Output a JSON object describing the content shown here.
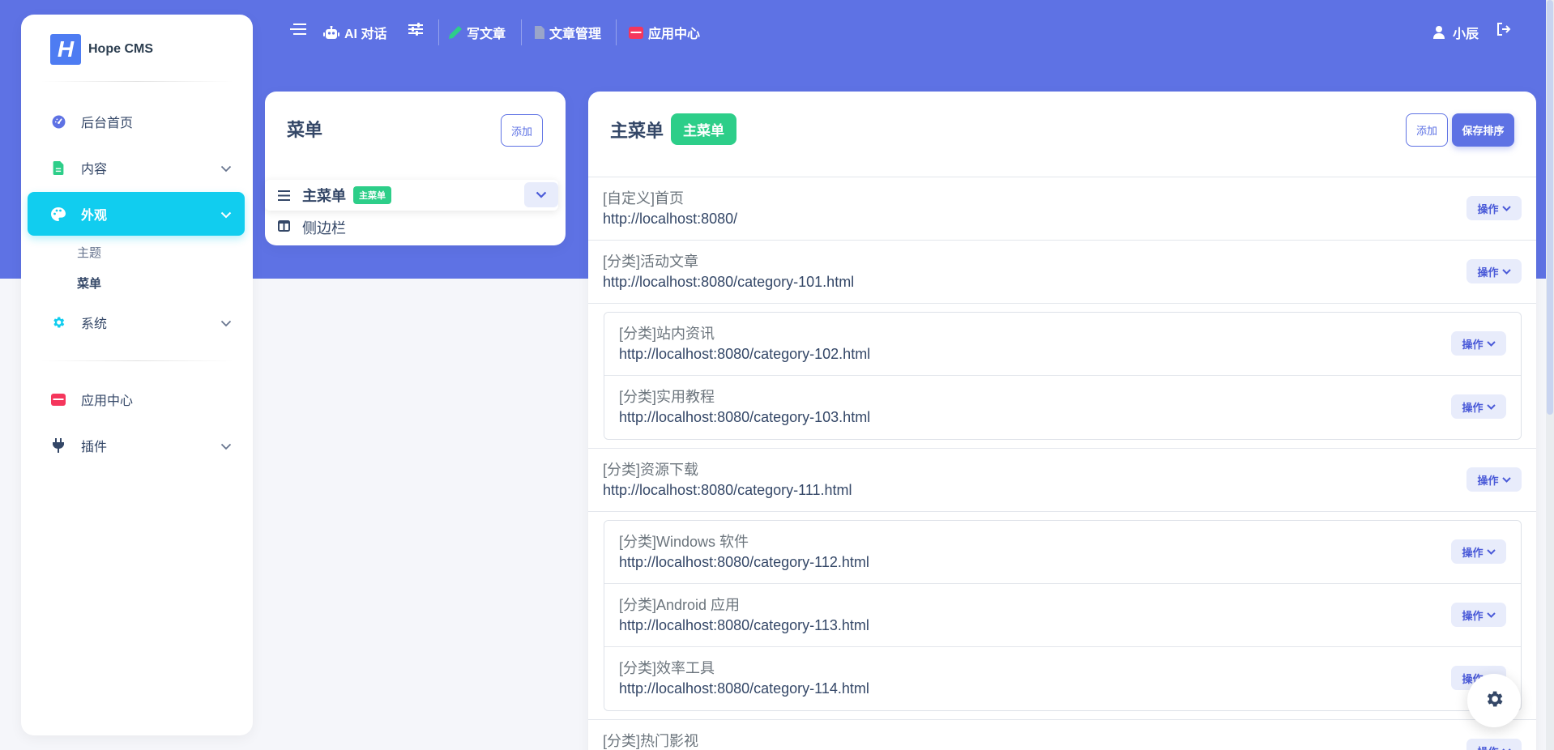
{
  "app": {
    "name": "Hope CMS",
    "logo_letter": "H",
    "accent": "#5e72e4",
    "active_nav_color": "#11cdef",
    "badge_color": "#2dce89"
  },
  "sidebar": {
    "items": [
      {
        "label": "后台首页",
        "icon": "dashboard-icon"
      },
      {
        "label": "内容",
        "icon": "document-icon",
        "icon_color": "#2dce89"
      },
      {
        "label": "外观",
        "icon": "palette-icon",
        "active": true
      },
      {
        "label": "系统",
        "icon": "gear-icon",
        "icon_color": "#11cdef"
      },
      {
        "label": "应用中心",
        "icon": "store-icon",
        "icon_color": "#f5365c"
      },
      {
        "label": "插件",
        "icon": "plug-icon"
      }
    ],
    "appearance_sub": [
      {
        "label": "主题"
      },
      {
        "label": "菜单",
        "current": true
      }
    ]
  },
  "header": {
    "ai_chat": "AI 对话",
    "write_article": "写文章",
    "article_manage": "文章管理",
    "app_center": "应用中心",
    "user_name": "小辰"
  },
  "menu_card": {
    "title": "菜单",
    "add_label": "添加",
    "menus": [
      {
        "label": "主菜单",
        "badge": "主菜单",
        "selected": true
      },
      {
        "label": "侧边栏"
      }
    ]
  },
  "main_card": {
    "title": "主菜单",
    "badge": "主菜单",
    "add_label": "添加",
    "save_order_label": "保存排序",
    "op_label": "操作",
    "items": [
      {
        "title": "[自定义]首页",
        "url": "http://localhost:8080/"
      },
      {
        "title": "[分类]活动文章",
        "url": "http://localhost:8080/category-101.html",
        "children": [
          {
            "title": "[分类]站内资讯",
            "url": "http://localhost:8080/category-102.html"
          },
          {
            "title": "[分类]实用教程",
            "url": "http://localhost:8080/category-103.html"
          }
        ]
      },
      {
        "title": "[分类]资源下载",
        "url": "http://localhost:8080/category-111.html",
        "children": [
          {
            "title": "[分类]Windows 软件",
            "url": "http://localhost:8080/category-112.html"
          },
          {
            "title": "[分类]Android 应用",
            "url": "http://localhost:8080/category-113.html"
          },
          {
            "title": "[分类]效率工具",
            "url": "http://localhost:8080/category-114.html"
          }
        ]
      },
      {
        "title": "[分类]热门影视",
        "url": ""
      }
    ]
  }
}
